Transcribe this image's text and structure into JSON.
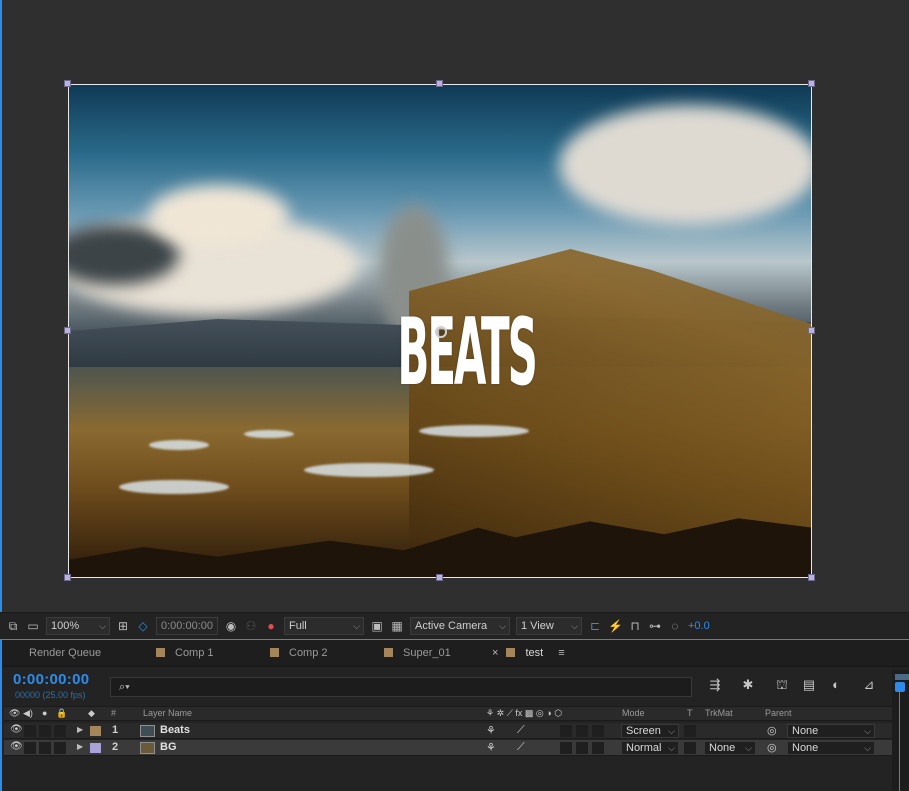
{
  "viewer": {
    "overlay_text": "BEATS"
  },
  "viewer_toolbar": {
    "zoom": "100%",
    "timecode": "0:00:00:00",
    "resolution": "Full",
    "camera": "Active Camera",
    "views": "1 View",
    "exposure": "+0.0"
  },
  "timeline": {
    "tabs": [
      {
        "label": "Render Queue",
        "color": ""
      },
      {
        "label": "Comp 1",
        "color": "#a5865a"
      },
      {
        "label": "Comp 2",
        "color": "#a5865a"
      },
      {
        "label": "Super_01",
        "color": "#a5865a"
      },
      {
        "label": "test",
        "color": "#a5865a",
        "active": true
      }
    ],
    "current_time": "0:00:00:00",
    "fps": "00000 (25.00 fps)",
    "search_placeholder": "",
    "columns": {
      "hash": "#",
      "layer_name": "Layer Name",
      "mode": "Mode",
      "t": "T",
      "trkmat": "TrkMat",
      "parent": "Parent"
    },
    "layers": [
      {
        "num": "1",
        "name": "Beats",
        "mode": "Screen",
        "trkmat": "",
        "parent": "None",
        "label_color": "#a5865a",
        "selected": false
      },
      {
        "num": "2",
        "name": "BG",
        "mode": "Normal",
        "trkmat": "None",
        "parent": "None",
        "label_color": "#a9a2d6",
        "selected": true
      }
    ]
  },
  "colors": {
    "accent": "#2d8ceb",
    "panel_bg": "#232323"
  }
}
